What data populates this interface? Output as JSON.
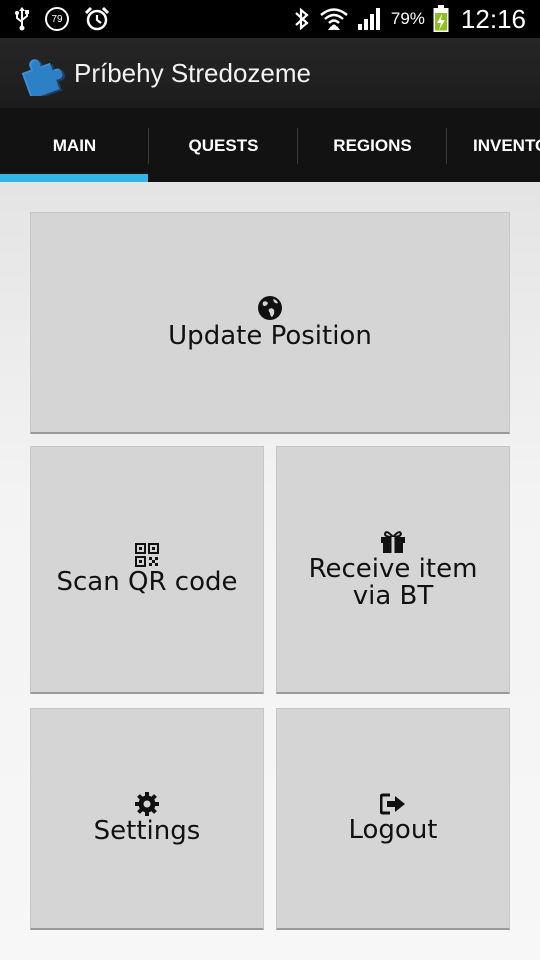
{
  "status_bar": {
    "notification_badge": "79",
    "battery_percent": "79%",
    "time": "12:16",
    "icons": [
      "usb-icon",
      "notification-badge-icon",
      "alarm-icon",
      "bluetooth-icon",
      "wifi-icon",
      "signal-icon",
      "battery-charging-icon"
    ]
  },
  "action_bar": {
    "title": "Príbehy Stredozeme",
    "icon": "puzzle-piece-icon"
  },
  "tabs": [
    {
      "label": "MAIN",
      "selected": true
    },
    {
      "label": "QUESTS",
      "selected": false
    },
    {
      "label": "REGIONS",
      "selected": false
    },
    {
      "label": "INVENTORY",
      "selected": false
    }
  ],
  "tiles": {
    "update_position": {
      "label": "Update Position",
      "icon": "globe-icon"
    },
    "scan_qr": {
      "label": "Scan QR code",
      "icon": "qr-code-icon"
    },
    "receive_item": {
      "label": "Receive item via BT",
      "icon": "gift-icon"
    },
    "settings": {
      "label": "Settings",
      "icon": "gear-icon"
    },
    "logout": {
      "label": "Logout",
      "icon": "logout-icon"
    }
  },
  "colors": {
    "tab_indicator": "#33b5e5",
    "tile_background": "#d5d5d5",
    "action_bar": "#222222"
  }
}
